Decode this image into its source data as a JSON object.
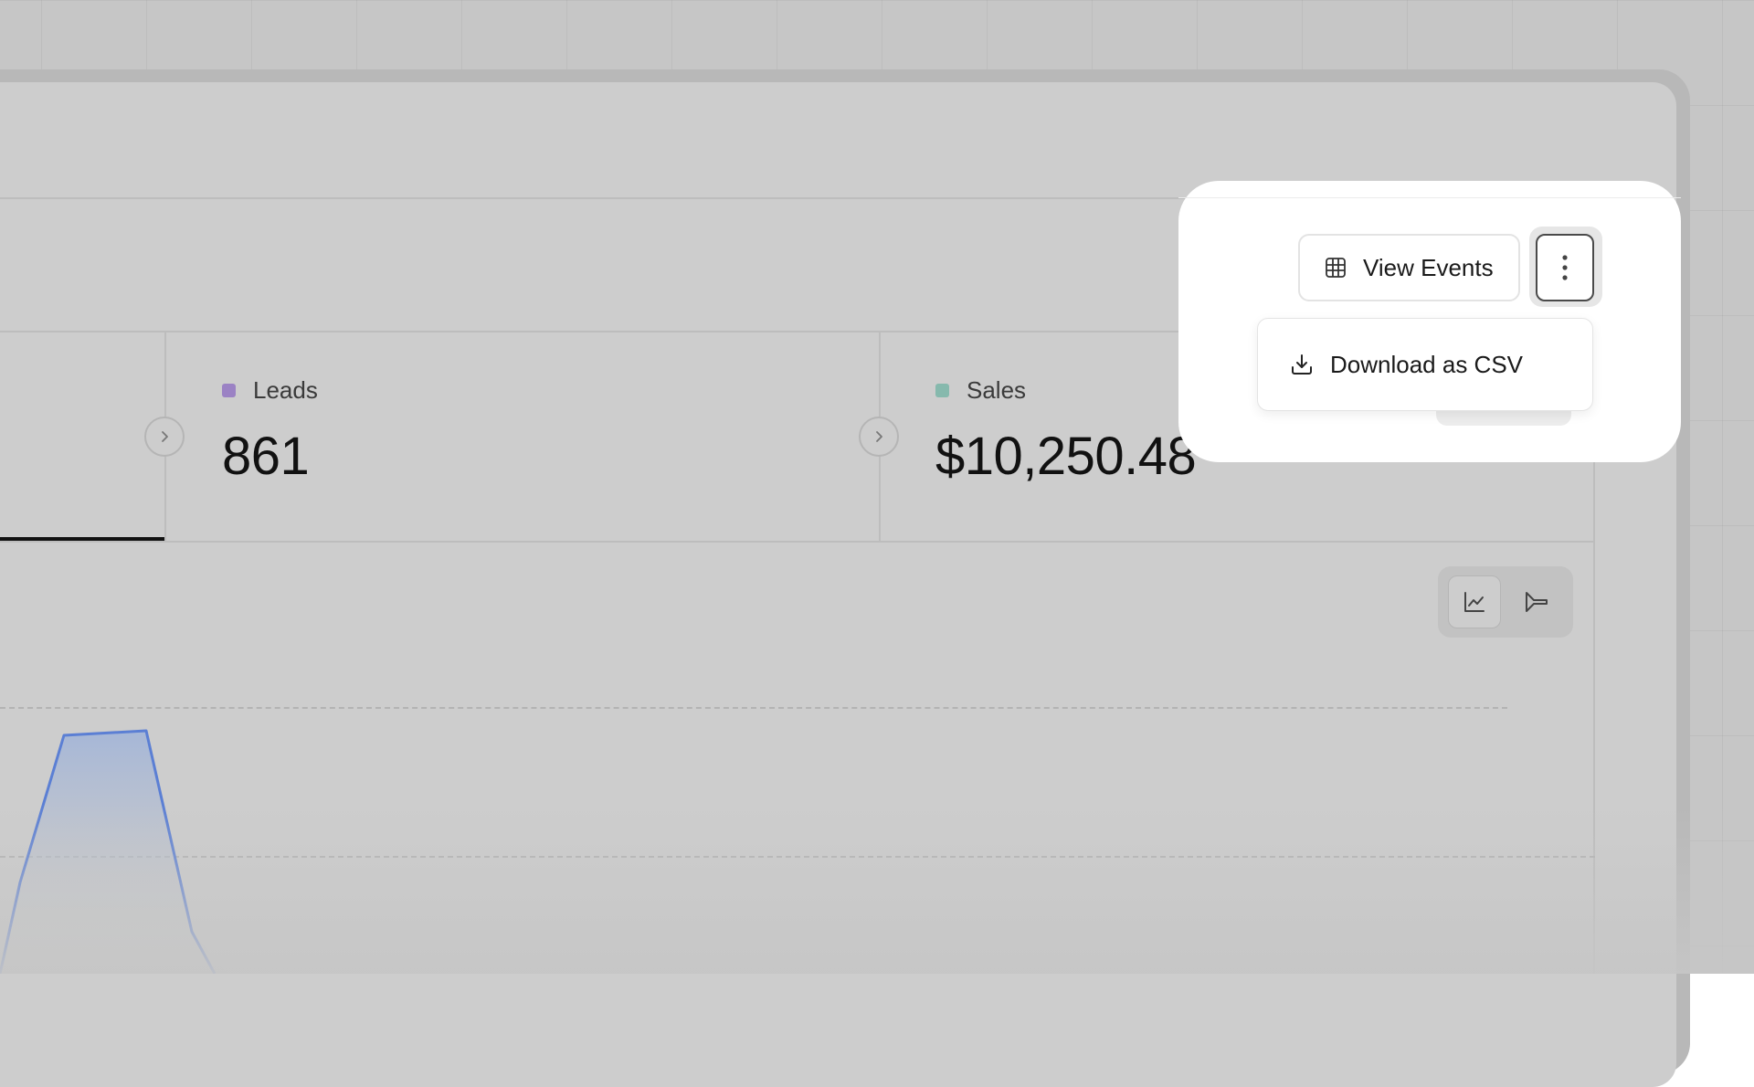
{
  "toolbar": {
    "view_events_label": "View Events",
    "more_icon": "more-vertical-icon",
    "table_icon": "table-grid-icon"
  },
  "dropdown": {
    "items": [
      {
        "label": "Download as CSV",
        "icon": "download-icon"
      }
    ]
  },
  "metrics": [
    {
      "label": "Leads",
      "value": "861",
      "color": "#9b82c4"
    },
    {
      "label": "Sales",
      "value": "$10,250.48",
      "color": "#86b9ad"
    }
  ],
  "chart_toggle": {
    "options": [
      {
        "name": "line-chart",
        "icon": "line-chart-icon",
        "active": true
      },
      {
        "name": "funnel-chart",
        "icon": "funnel-icon",
        "active": false
      }
    ]
  },
  "colors": {
    "background": "#c6c6c6",
    "card": "#cdcdcd",
    "chart_line": "#5b7fd4",
    "spotlight": "#ffffff"
  }
}
